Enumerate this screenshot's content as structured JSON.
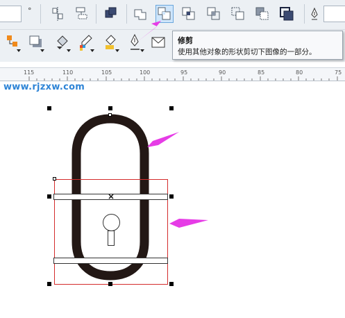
{
  "toolbar": {
    "degree_symbol": "°",
    "buttons": [
      "align-distribute-icon",
      "dock-order-icon",
      "combine-icon",
      "weld-icon",
      "trim-icon",
      "intersect-icon",
      "simplify-icon",
      "front-minus-back-icon",
      "back-minus-front-icon",
      "boundary-icon",
      "pen-tool-icon"
    ],
    "active_button": "trim-icon"
  },
  "tools": [
    "smart-fill-icon",
    "drop-shadow-icon",
    "fill-bucket-icon",
    "eyedropper-icon",
    "paint-bucket-icon",
    "fountain-pen-icon",
    "envelope-icon"
  ],
  "tooltip": {
    "title": "修剪",
    "description": "使用其他对象的形状剪切下图像的一部分。"
  },
  "ruler": {
    "labels": [
      "115",
      "110",
      "105",
      "100",
      "95",
      "90",
      "85",
      "80",
      "75"
    ]
  },
  "watermark": "www.rjzxw.com",
  "colors": {
    "toolbar_bg": "#ecf0f4",
    "lock_shackle": "#231815",
    "selection_rect": "#d32c2c",
    "arrow": "#e63ce6",
    "watermark": "#2e84d6"
  }
}
